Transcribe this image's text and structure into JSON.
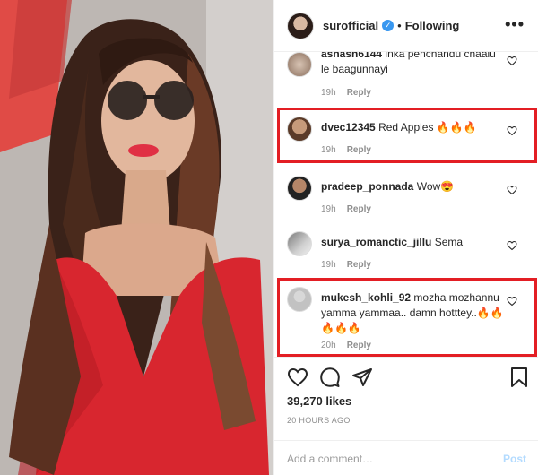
{
  "post": {
    "username": "surofficial",
    "separator": "•",
    "follow_status": "Following",
    "more_label": "•••"
  },
  "comments": [
    {
      "user": "ashash6144",
      "text": "inka penchandu chaalu le baagunnayi",
      "age": "19h",
      "reply": "Reply",
      "highlighted": false
    },
    {
      "user": "dvec12345",
      "text": "Red Apples 🔥🔥🔥",
      "age": "19h",
      "reply": "Reply",
      "highlighted": true
    },
    {
      "user": "pradeep_ponnada",
      "text": "Wow😍",
      "age": "19h",
      "reply": "Reply",
      "highlighted": false
    },
    {
      "user": "surya_romanctic_jillu",
      "text": "Sema",
      "age": "19h",
      "reply": "Reply",
      "highlighted": false
    },
    {
      "user": "mukesh_kohli_92",
      "text": "mozha mozhannu yamma yammaa.. damn hotttey..🔥🔥🔥🔥🔥",
      "age": "20h",
      "reply": "Reply",
      "highlighted": true
    }
  ],
  "footer": {
    "likes": "39,270 likes",
    "time_ago": "20 HOURS AGO",
    "comment_placeholder": "Add a comment…",
    "post_label": "Post"
  },
  "colors": {
    "highlight": "#e31e24",
    "verified": "#3897f0",
    "post_disabled": "#b3dbff",
    "dress": "#d8262f"
  },
  "icons": [
    "verified-icon",
    "more-icon",
    "heart-icon",
    "comment-icon",
    "share-icon",
    "bookmark-icon"
  ]
}
